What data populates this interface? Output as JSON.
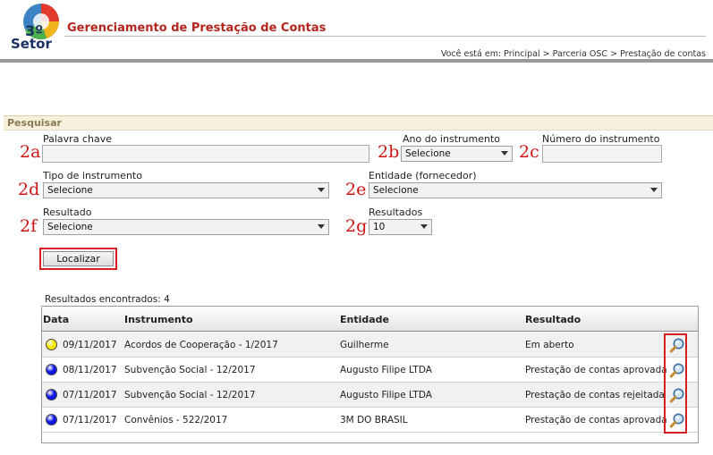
{
  "header": {
    "logo_text_top": "3º",
    "logo_text_bottom": "Setor",
    "title": "Gerenciamento de Prestação de Contas",
    "breadcrumb": "Você está em: Principal > Parceria OSC > Prestação de contas"
  },
  "search": {
    "section_title": "Pesquisar",
    "labels": {
      "keyword": "Palavra chave",
      "year": "Ano do instrumento",
      "number": "Número do instrumento",
      "type": "Tipo de instrumento",
      "entity": "Entidade (fornecedor)",
      "result": "Resultado",
      "results_per_page": "Resultados"
    },
    "values": {
      "keyword": "",
      "year": "Selecione",
      "number": "",
      "type": "Selecione",
      "entity": "Selecione",
      "result": "Selecione",
      "results_per_page": "10"
    },
    "annotations": {
      "keyword": "2a",
      "year": "2b",
      "number": "2c",
      "type": "2d",
      "entity": "2e",
      "result": "2f",
      "results_per_page": "2g"
    },
    "button_label": "Localizar"
  },
  "results": {
    "count_label": "Resultados encontrados:",
    "count": "4",
    "columns": [
      "Data",
      "Instrumento",
      "Entidade",
      "Resultado"
    ],
    "rows": [
      {
        "status_color": "#f2e600",
        "date": "09/11/2017",
        "instrument": "Acordos de Cooperação - 1/2017",
        "entity": "Guilherme",
        "result": "Em aberto"
      },
      {
        "status_color": "#0d14e6",
        "date": "08/11/2017",
        "instrument": "Subvenção Social - 12/2017",
        "entity": "Augusto Filipe LTDA",
        "result": "Prestação de contas aprovada"
      },
      {
        "status_color": "#0d14e6",
        "date": "07/11/2017",
        "instrument": "Subvenção Social - 12/2017",
        "entity": "Augusto Filipe LTDA",
        "result": "Prestação de contas rejeitada"
      },
      {
        "status_color": "#0d14e6",
        "date": "07/11/2017",
        "instrument": "Convênios - 522/2017",
        "entity": "3M DO BRASIL",
        "result": "Prestação de contas aprovada"
      }
    ]
  }
}
